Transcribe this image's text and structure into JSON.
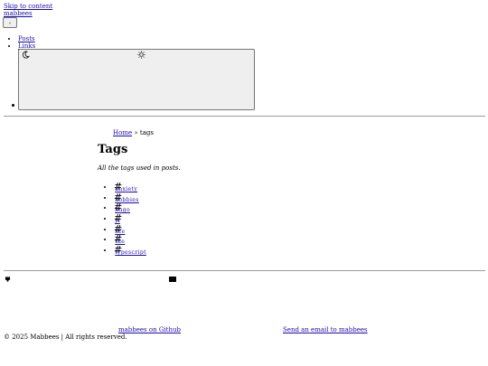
{
  "skip_link": "Skip to content",
  "brand": "mabbees",
  "nav": {
    "items": [
      "Posts",
      "Links"
    ]
  },
  "theme_toggle": {
    "dark_icon": "moon-icon",
    "light_icon": "sun-icon"
  },
  "breadcrumb": {
    "home": "Home",
    "separator": "»",
    "current": "tags"
  },
  "page": {
    "title": "Tags",
    "description": "All the tags used in posts."
  },
  "tags": {
    "hash": "#",
    "items": [
      "anxiety",
      "hobbies",
      "hugo",
      "js",
      "life",
      "the",
      "typescript"
    ]
  },
  "footer": {
    "github_icon": "github-icon",
    "mail_icon": "mail-icon",
    "github_link": " mabbees on Github ",
    "mail_link": " Send an email to mabbees ",
    "copyright": "© 2025 Mabbees  |  All rights reserved."
  },
  "colors": {
    "link": "#1a0dab",
    "button_bg": "#efefef",
    "divider": "#9a9a9a"
  }
}
